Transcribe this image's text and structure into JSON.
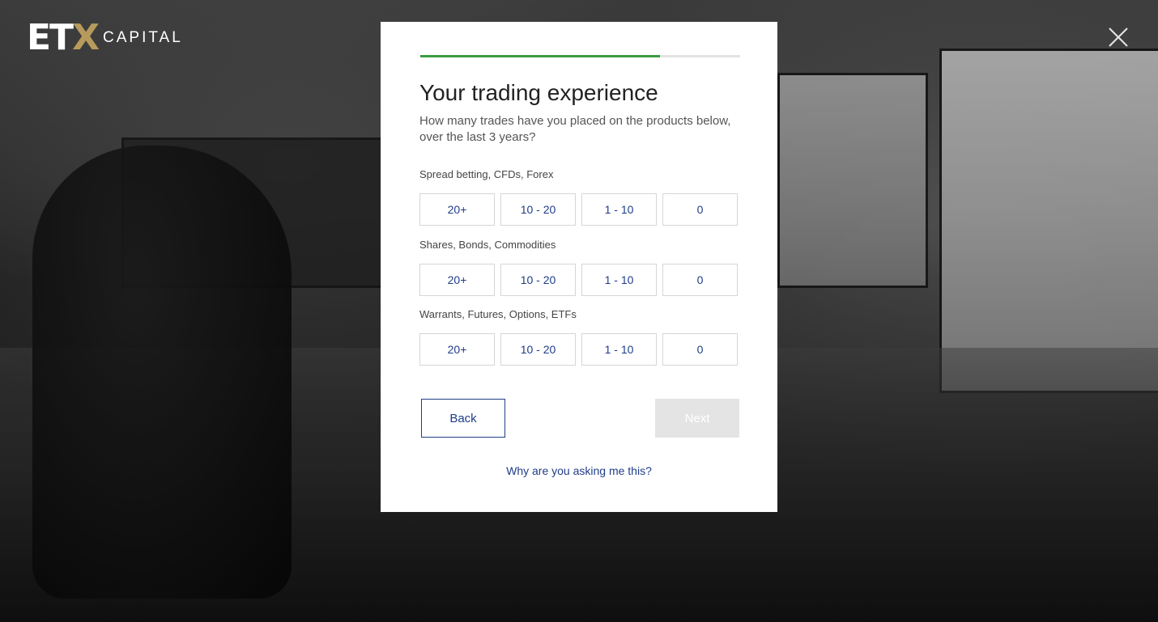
{
  "brand": {
    "logo_mark_prefix": "ET",
    "logo_mark_x": "X",
    "logo_word": "CAPITAL",
    "accent_gold": "#b79b5c"
  },
  "close": {
    "icon": "close-icon"
  },
  "modal": {
    "progress": 0.75,
    "progress_color": "#3b9b3f",
    "title": "Your trading experience",
    "subtitle": "How many trades have you placed on the products below, over the last 3 years?",
    "questions": [
      {
        "label": "Spread betting, CFDs, Forex",
        "options": [
          "20+",
          "10 - 20",
          "1 - 10",
          "0"
        ]
      },
      {
        "label": "Shares, Bonds, Commodities",
        "options": [
          "20+",
          "10 - 20",
          "1 - 10",
          "0"
        ]
      },
      {
        "label": "Warrants, Futures, Options, ETFs",
        "options": [
          "20+",
          "10 - 20",
          "1 - 10",
          "0"
        ]
      }
    ],
    "back_label": "Back",
    "next_label": "Next",
    "why_link": "Why are you asking me this?",
    "primary_color": "#1f3d87"
  }
}
